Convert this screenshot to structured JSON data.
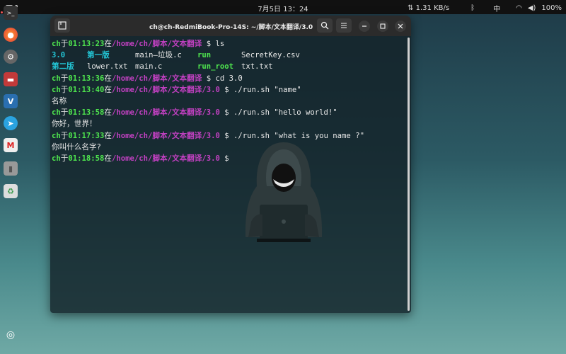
{
  "topbar": {
    "clock": "7月5日  13：24",
    "net_speed": "⇅ 1.31 KB/s",
    "bluetooth": "ᛒ",
    "ime": "中",
    "wifi": "◠",
    "volume": "◀)",
    "battery": "100%"
  },
  "dock": [
    {
      "name": "terminal",
      "glyph": ">_"
    },
    {
      "name": "firefox",
      "glyph": "●"
    },
    {
      "name": "settings",
      "glyph": "⚙"
    },
    {
      "name": "files",
      "glyph": "▬"
    },
    {
      "name": "vim",
      "glyph": "V"
    },
    {
      "name": "telegram",
      "glyph": "➤"
    },
    {
      "name": "mail",
      "glyph": "M"
    },
    {
      "name": "disk",
      "glyph": "▮"
    },
    {
      "name": "trash",
      "glyph": "♻"
    },
    {
      "name": "ubuntu",
      "glyph": "◎"
    }
  ],
  "window": {
    "title": "ch@ch-RedmiBook-Pro-14S: ~/脚本/文本翻译/3.0"
  },
  "terminal": {
    "user": "ch",
    "at": "于",
    "in": "在",
    "lines": [
      {
        "type": "prompt",
        "time": "01:13:23",
        "path": "/home/ch/脚本/文本翻译",
        "cmd": "ls"
      },
      {
        "type": "ls1",
        "a": "3.0",
        "b": "第一版",
        "c": "main—垃圾.c",
        "d": "run",
        "e": "SecretKey.csv"
      },
      {
        "type": "ls2",
        "a": "第二版",
        "b": "lower.txt",
        "c": "main.c",
        "d": "run_root",
        "e": "txt.txt"
      },
      {
        "type": "prompt",
        "time": "01:13:36",
        "path": "/home/ch/脚本/文本翻译",
        "cmd": "cd 3.0"
      },
      {
        "type": "prompt",
        "time": "01:13:40",
        "path": "/home/ch/脚本/文本翻译/3.0",
        "cmd": "./run.sh \"name\""
      },
      {
        "type": "out",
        "text": "名称"
      },
      {
        "type": "prompt",
        "time": "01:13:58",
        "path": "/home/ch/脚本/文本翻译/3.0",
        "cmd": "./run.sh \"hello world!\""
      },
      {
        "type": "out",
        "text": "你好，世界！"
      },
      {
        "type": "prompt",
        "time": "01:17:33",
        "path": "/home/ch/脚本/文本翻译/3.0",
        "cmd": "./run.sh \"what is you name ?\""
      },
      {
        "type": "out",
        "text": "你叫什么名字?"
      },
      {
        "type": "prompt",
        "time": "01:18:58",
        "path": "/home/ch/脚本/文本翻译/3.0",
        "cmd": ""
      }
    ],
    "prompt_symbol": "$"
  }
}
